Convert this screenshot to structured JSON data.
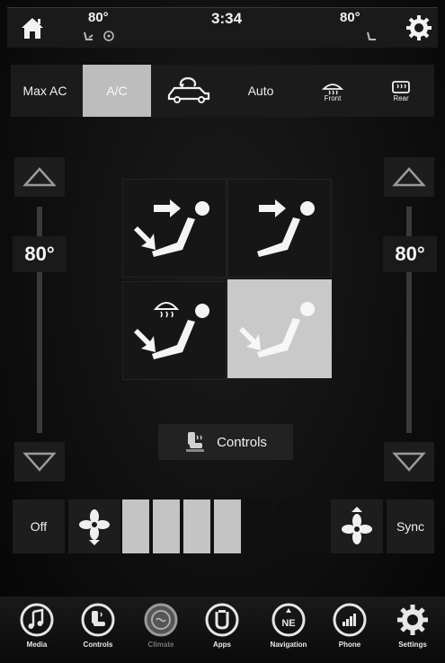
{
  "status_bar": {
    "left_temp": "80°",
    "time": "3:34",
    "right_temp": "80°"
  },
  "modes": [
    {
      "label": "Max AC",
      "icon": "max-ac"
    },
    {
      "label": "A/C",
      "icon": "ac",
      "active": true
    },
    {
      "label": "",
      "icon": "recirculate-icon"
    },
    {
      "label": "Auto",
      "icon": "auto"
    },
    {
      "label": "Front",
      "icon": "front-defrost-icon"
    },
    {
      "label": "Rear",
      "icon": "rear-defrost-icon"
    }
  ],
  "left_temp": {
    "value": "80°"
  },
  "right_temp": {
    "value": "80°"
  },
  "airflow_modes": [
    {
      "name": "panel-floor",
      "active": false
    },
    {
      "name": "panel",
      "active": false
    },
    {
      "name": "defrost-floor",
      "active": false
    },
    {
      "name": "floor",
      "active": true
    }
  ],
  "controls_button": {
    "label": "Controls"
  },
  "fan": {
    "off_label": "Off",
    "sync_label": "Sync",
    "level": 4,
    "max_level": 7
  },
  "bottom_nav": [
    {
      "label": "Media",
      "icon": "music-note-icon"
    },
    {
      "label": "Controls",
      "icon": "seat-controls-icon"
    },
    {
      "label": "Climate",
      "icon": "climate-icon",
      "dim": true
    },
    {
      "label": "Apps",
      "icon": "apps-icon"
    },
    {
      "label": "Navigation",
      "icon": "compass-icon"
    },
    {
      "label": "Phone",
      "icon": "phone-signal-icon"
    },
    {
      "label": "Settings",
      "icon": "gear-icon"
    }
  ]
}
